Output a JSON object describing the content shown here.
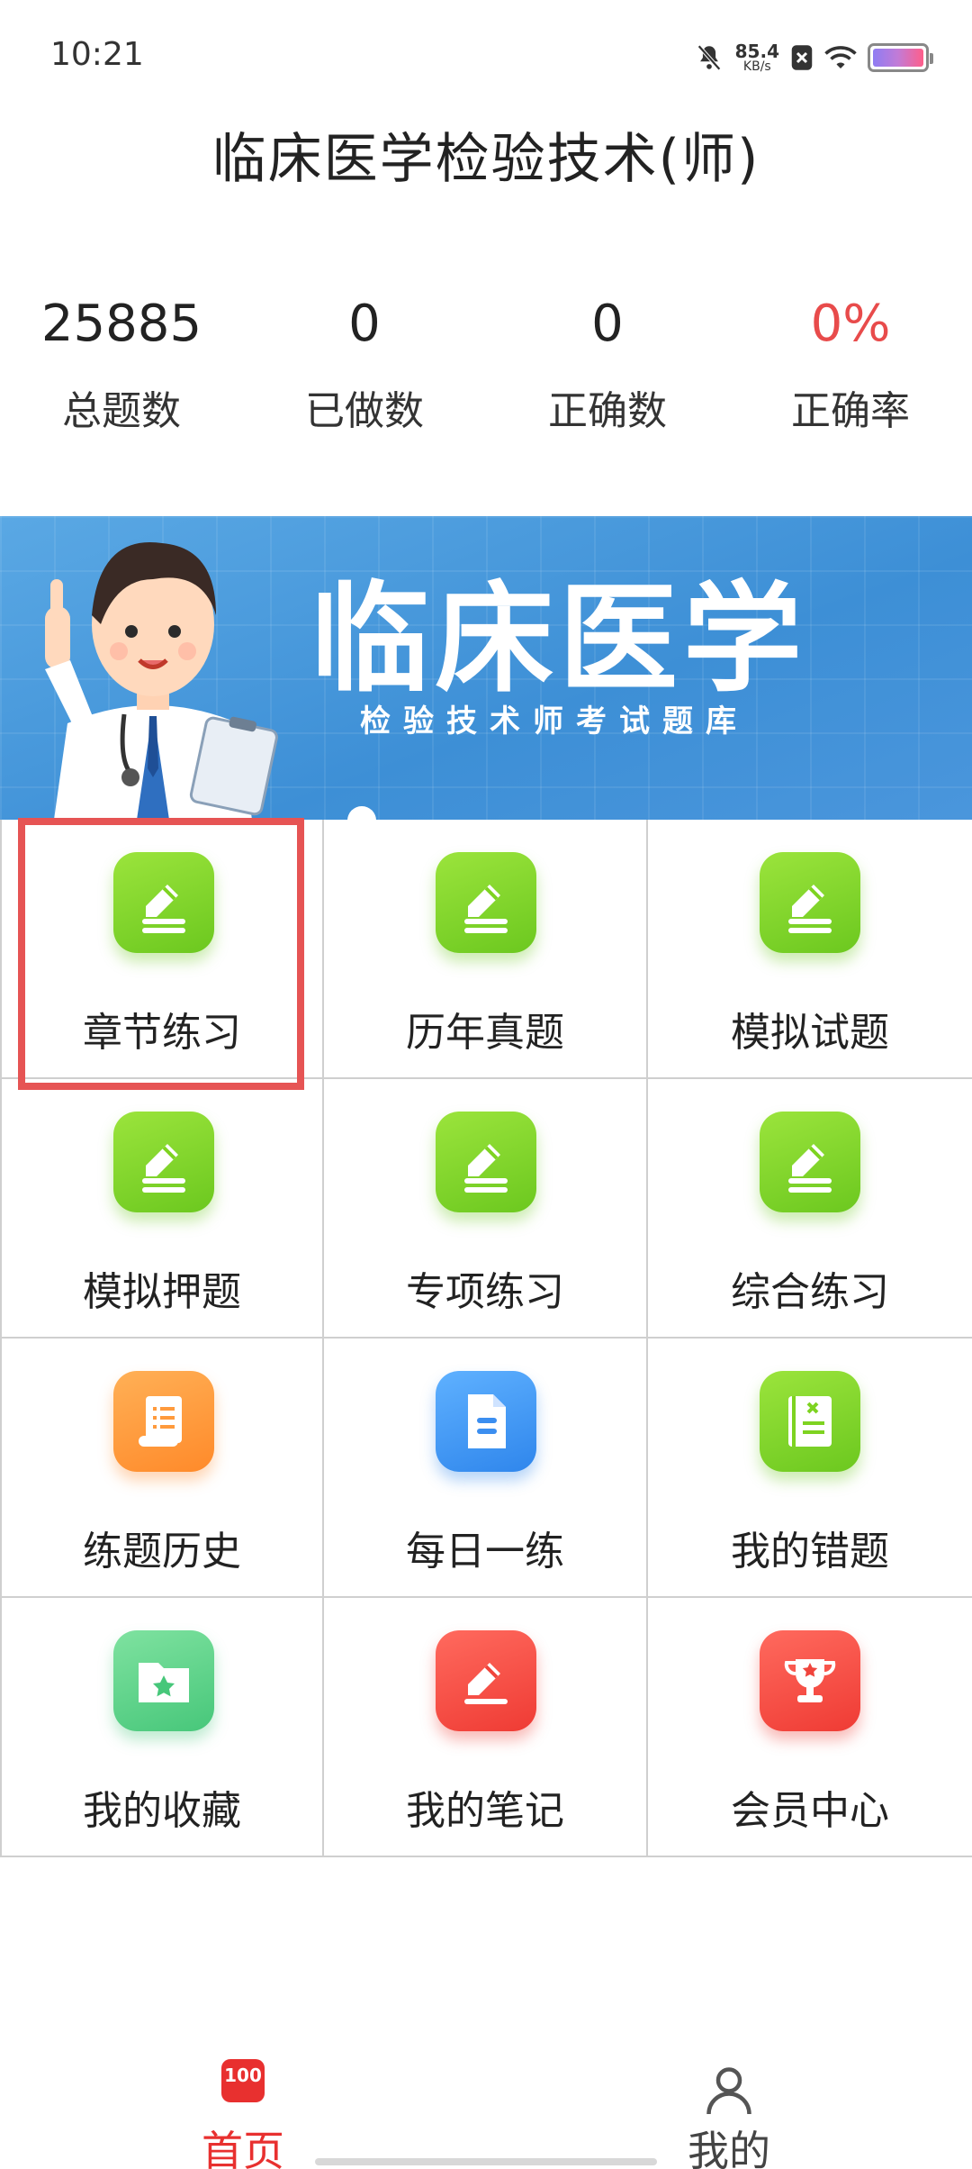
{
  "status_bar": {
    "time": "10:21",
    "net_speed_value": "85.4",
    "net_speed_unit": "KB/s"
  },
  "header": {
    "title": "临床医学检验技术(师)"
  },
  "stats": [
    {
      "value": "25885",
      "label": "总题数"
    },
    {
      "value": "0",
      "label": "已做数"
    },
    {
      "value": "0",
      "label": "正确数"
    },
    {
      "value": "0%",
      "label": "正确率"
    }
  ],
  "banner": {
    "title": "临床医学",
    "subtitle": "检验技术师考试题库"
  },
  "menu": [
    {
      "label": "章节练习",
      "icon": "pencil-icon",
      "color": "#7ed321"
    },
    {
      "label": "历年真题",
      "icon": "pencil-icon",
      "color": "#7ed321"
    },
    {
      "label": "模拟试题",
      "icon": "pencil-icon",
      "color": "#7ed321"
    },
    {
      "label": "模拟押题",
      "icon": "pencil-icon",
      "color": "#7ed321"
    },
    {
      "label": "专项练习",
      "icon": "pencil-icon",
      "color": "#7ed321"
    },
    {
      "label": "综合练习",
      "icon": "pencil-icon",
      "color": "#7ed321"
    },
    {
      "label": "练题历史",
      "icon": "scroll-icon",
      "color": "#ff9a3c"
    },
    {
      "label": "每日一练",
      "icon": "document-icon",
      "color": "#3b8ef0"
    },
    {
      "label": "我的错题",
      "icon": "wrong-book-icon",
      "color": "#7ed321"
    },
    {
      "label": "我的收藏",
      "icon": "folder-star-icon",
      "color": "#5ad38a"
    },
    {
      "label": "我的笔记",
      "icon": "pencil-icon",
      "color": "#f0443c"
    },
    {
      "label": "会员中心",
      "icon": "trophy-icon",
      "color": "#f0443c"
    }
  ],
  "bottom_nav": {
    "home": {
      "label": "首页",
      "badge": "100"
    },
    "mine": {
      "label": "我的"
    }
  },
  "colors": {
    "accent": "#e8302f",
    "highlight_box": "#e65454",
    "banner": "#4a96dc"
  }
}
